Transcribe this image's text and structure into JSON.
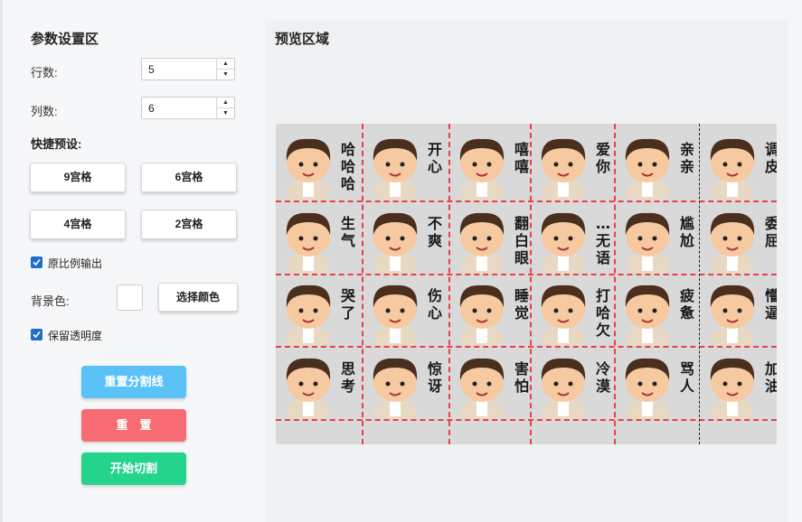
{
  "settings": {
    "title": "参数设置区",
    "rows_label": "行数:",
    "rows_value": "5",
    "cols_label": "列数:",
    "cols_value": "6",
    "presets_title": "快捷预设:",
    "presets": [
      "9宫格",
      "6宫格",
      "4宫格",
      "2宫格"
    ],
    "keep_ratio_label": "原比例输出",
    "keep_ratio_checked": true,
    "bg_color_label": "背景色:",
    "bg_color_value": "#ffffff",
    "choose_color_label": "选择颜色",
    "keep_alpha_label": "保留透明度",
    "keep_alpha_checked": true,
    "reset_lines_label": "重置分割线",
    "reset_label": "重　置",
    "start_label": "开始切割"
  },
  "preview": {
    "title": "预览区域",
    "captions": [
      [
        "哈哈哈",
        "开心",
        "嘻嘻",
        "爱你",
        "亲亲",
        "调皮"
      ],
      [
        "生气",
        "不爽",
        "翻白眼",
        "…无语",
        "尴尬",
        "委屈"
      ],
      [
        "哭了",
        "伤心",
        "睡觉",
        "打哈欠",
        "疲惫",
        "懵逼"
      ],
      [
        "思考",
        "惊讶",
        "害怕",
        "冷漠",
        "骂人",
        "加油"
      ],
      [
        "",
        "",
        "",
        "",
        "",
        ""
      ]
    ]
  },
  "colors": {
    "accent": "#1e6fc8",
    "reset_lines_btn": "#5bc2f7",
    "reset_btn": "#f76b72",
    "start_btn": "#24d38c",
    "grid_line": "#e8404a"
  }
}
